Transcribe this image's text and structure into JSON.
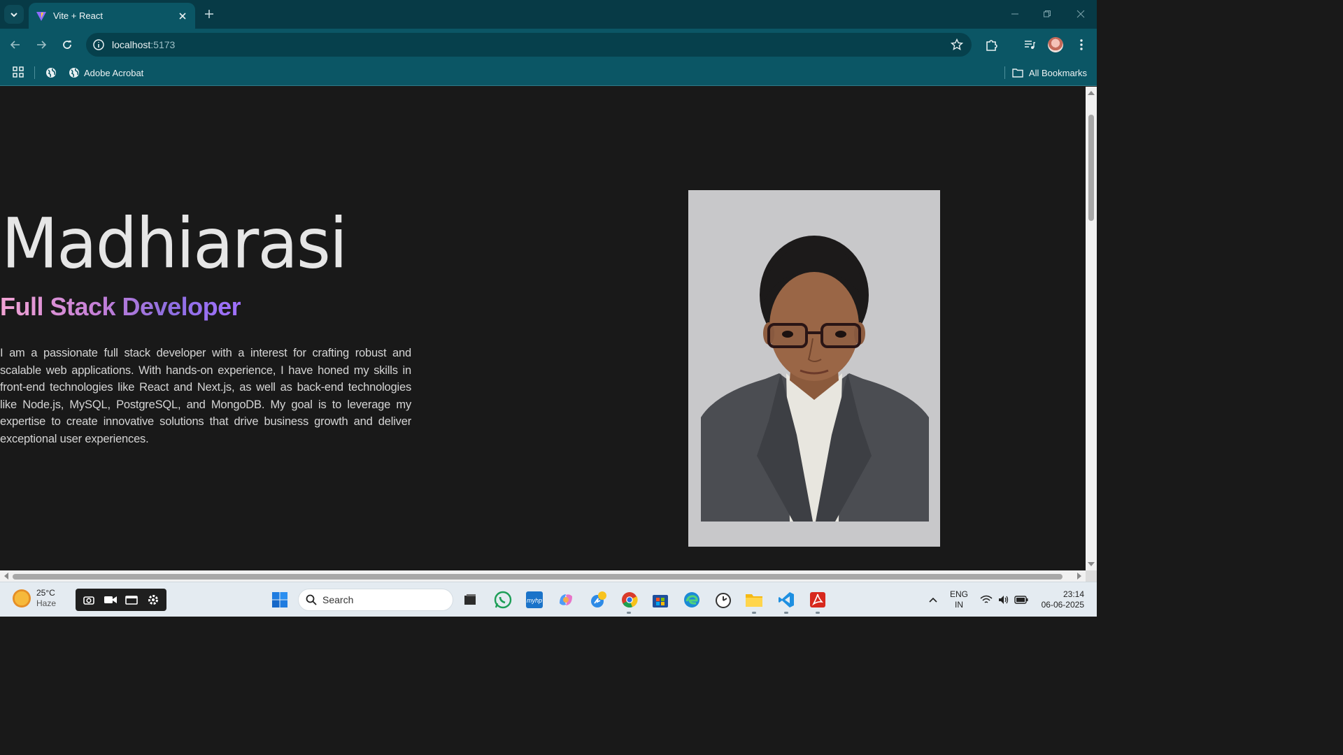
{
  "browser": {
    "tab_title": "Vite + React",
    "url_host": "localhost",
    "url_port": ":5173",
    "bookmarks": [
      {
        "label": "",
        "icon": "globe-icon"
      },
      {
        "label": "Adobe Acrobat",
        "icon": "globe-icon"
      }
    ],
    "all_bookmarks": "All Bookmarks"
  },
  "page": {
    "name": "Madhiarasi",
    "role": "Full Stack Developer",
    "bio": "I am a passionate full stack developer with a interest for crafting robust and scalable web applications. With hands-on experience, I have honed my skills in front-end technologies like React and Next.js, as well as back-end technologies like Node.js, MySQL, PostgreSQL, and MongoDB. My goal is to leverage my expertise to create innovative solutions that drive business growth and deliver exceptional user experiences.",
    "photo": "profile-photo",
    "vertical_scroll_fraction": 0.0,
    "horizontal_scroll_fraction": 0.0
  },
  "taskbar": {
    "weather_temp": "25°C",
    "weather_desc": "Haze",
    "search_placeholder": "Search",
    "lang_top": "ENG",
    "lang_bottom": "IN",
    "time": "23:14",
    "date": "06-06-2025"
  },
  "colors": {
    "titlebar": "#073a46",
    "toolbar": "#0b5665",
    "page_bg": "#191919",
    "role_gradient_start": "#f2a4d4",
    "role_gradient_end": "#a070ff"
  }
}
